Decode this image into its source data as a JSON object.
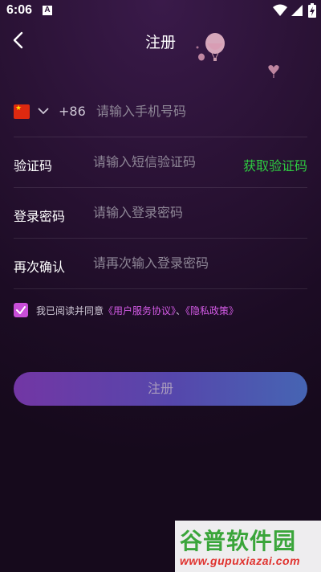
{
  "status_bar": {
    "time": "6:06",
    "notification_icon_letter": "A",
    "icons": [
      "wifi-icon",
      "signal-icon",
      "battery-charging-icon"
    ]
  },
  "nav": {
    "title": "注册",
    "back_icon": "chevron-left-icon"
  },
  "phone": {
    "country_flag": "china-flag-icon",
    "country_code": "+86",
    "placeholder": "请输入手机号码",
    "value": ""
  },
  "verify_code": {
    "label": "验证码",
    "placeholder": "请输入短信验证码",
    "value": "",
    "get_code_label": "获取验证码"
  },
  "password": {
    "label": "登录密码",
    "placeholder": "请输入登录密码",
    "value": ""
  },
  "confirm_password": {
    "label": "再次确认",
    "placeholder": "请再次输入登录密码",
    "value": ""
  },
  "agreement": {
    "checked": true,
    "prefix": "我已阅读并同意",
    "user_agreement": "《用户服务协议》",
    "separator": "、",
    "privacy_policy": "《隐私政策》"
  },
  "register_button": {
    "label": "注册"
  },
  "watermark": {
    "title": "谷普软件园",
    "url": "www.gupuxiazai.com"
  },
  "colors": {
    "accent_green": "#2ecc40",
    "accent_pink": "#d45be6",
    "checkbox": "#c84ed8",
    "button_start": "#7a3ab0",
    "button_end": "#4a6cc0"
  }
}
